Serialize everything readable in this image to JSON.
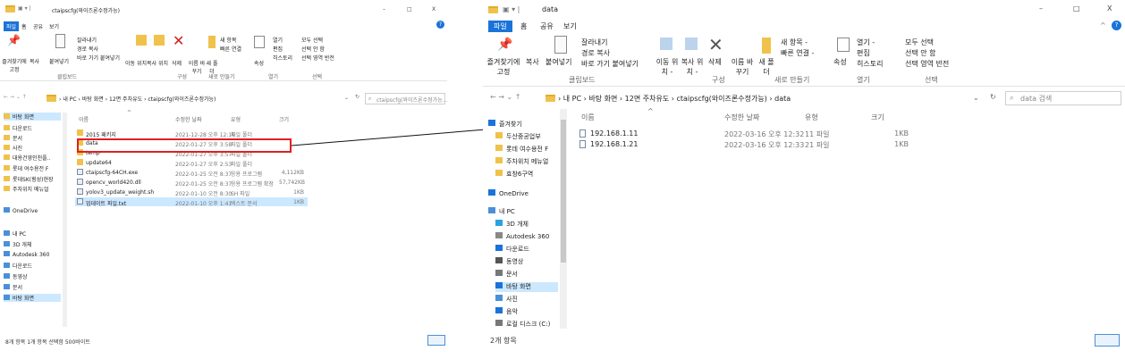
{
  "left": {
    "title": "ctaipscfg(와이즈론수정가능)",
    "tabs": [
      "파일",
      "홈",
      "공유",
      "보기"
    ],
    "ribbon": {
      "btn_pin": "즐겨찾기에 고정",
      "btn_copy": "복사",
      "btn_paste": "붙여넣기",
      "btn_cut": "잘라내기",
      "btn_copypath": "경로 복사",
      "btn_shortcut": "바로 가기 붙여넣기",
      "btn_move": "이동 위치",
      "btn_copyto": "복사 위치",
      "btn_delete": "삭제",
      "btn_rename": "이름 바꾸기",
      "btn_newfolder": "새 폴더",
      "btn_newitem": "새 항목",
      "btn_easyaccess": "빠른 연결",
      "btn_props": "속성",
      "btn_open": "열기",
      "btn_edit": "편집",
      "btn_history": "히스토리",
      "btn_selall": "모두 선택",
      "btn_selnone": "선택 안 함",
      "btn_selinv": "선택 영역 반전",
      "grp_clipboard": "클립보드",
      "grp_organize": "구성",
      "grp_new": "새로 만들기",
      "grp_open": "열기",
      "grp_select": "선택"
    },
    "breadcrumb": [
      "내 PC",
      "바탕 화면",
      "12면 주차유도",
      "ctaipscfg(와이즈론수정가능)"
    ],
    "search_placeholder": "ctaipscfg(와이즈론수정가능...",
    "columns": [
      "이름",
      "수정한 날짜",
      "유형",
      "크기"
    ],
    "files": [
      {
        "name": "2015 패키지",
        "date": "2021-12-28 오후 12:19",
        "type": "파일 폴더",
        "size": ""
      },
      {
        "name": "data",
        "date": "2022-01-27 오후 3:58",
        "type": "파일 폴더",
        "size": ""
      },
      {
        "name": "temp",
        "date": "2022-01-27 오후 3:57",
        "type": "파일 폴더",
        "size": ""
      },
      {
        "name": "update64",
        "date": "2022-01-27 오후 2:53",
        "type": "파일 폴더",
        "size": ""
      },
      {
        "name": "ctaipscfg-64CH.exe",
        "date": "2022-01-25 오전 8:37",
        "type": "응용 프로그램",
        "size": "4,112KB"
      },
      {
        "name": "opencv_world420.dll",
        "date": "2022-01-25 오전 8:37",
        "type": "응용 프로그램 확장",
        "size": "57,742KB"
      },
      {
        "name": "yolov3_update_weight.sh",
        "date": "2022-01-10 오전 8:30",
        "type": "SH 파일",
        "size": "1KB"
      },
      {
        "name": "업데이트 파일.txt",
        "date": "2022-01-10 오후 1:41",
        "type": "텍스트 문서",
        "size": "1KB"
      }
    ],
    "nav": [
      "바탕 화면",
      "다운로드",
      "문서",
      "사진",
      "대용건영인천플..",
      "롯데 여수용전 F",
      "롯데SK(횡성)현장",
      "주차위치 메뉴얼",
      "OneDrive",
      "내 PC",
      "3D 개체",
      "Autodesk 360",
      "다운로드",
      "동영상",
      "문서",
      "바탕 화면"
    ],
    "status": "8개 항목   1개 항목 선택함 500바이트"
  },
  "right": {
    "title": "data",
    "tabs": [
      "파일",
      "홈",
      "공유",
      "보기"
    ],
    "ribbon": {
      "btn_pin": "즐겨찾기에 고정",
      "btn_copy": "복사",
      "btn_paste": "붙여넣기",
      "btn_cut": "잘라내기",
      "btn_copypath": "경로 복사",
      "btn_shortcut": "바로 가기 붙여넣기",
      "btn_move": "이동 위치 -",
      "btn_copyto": "복사 위치 -",
      "btn_delete": "삭제",
      "btn_rename": "이름 바꾸기",
      "btn_newfolder": "새 폴더",
      "btn_newitem": "새 항목 -",
      "btn_easyaccess": "빠른 연결 -",
      "btn_props": "속성",
      "btn_open": "열기 -",
      "btn_edit": "편집",
      "btn_history": "히스토리",
      "btn_selall": "모두 선택",
      "btn_selnone": "선택 안 함",
      "btn_selinv": "선택 영역 반전",
      "grp_clipboard": "클립보드",
      "grp_organize": "구성",
      "grp_new": "새로 만들기",
      "grp_open": "열기",
      "grp_select": "선택"
    },
    "breadcrumb": [
      "내 PC",
      "바탕 화면",
      "12면 주차유도",
      "ctaipscfg(와이즈론수정가능)",
      "data"
    ],
    "search_placeholder": "data 검색",
    "columns": [
      "이름",
      "수정한 날짜",
      "유형",
      "크기"
    ],
    "files": [
      {
        "name": "192.168.1.11",
        "date": "2022-03-16 오후 12:32",
        "type": "11 파일",
        "size": "1KB"
      },
      {
        "name": "192.168.1.21",
        "date": "2022-03-16 오후 12:33",
        "type": "21 파일",
        "size": "1KB"
      }
    ],
    "nav": [
      "즐겨찾기",
      "두산중공업부",
      "롯데 여수용전 F",
      "주차위치 메뉴얼",
      "효창6구역",
      "OneDrive",
      "내 PC",
      "3D 개체",
      "Autodesk 360",
      "다운로드",
      "동영상",
      "문서",
      "바탕 화면",
      "사진",
      "음악",
      "로컬 디스크 (C:)"
    ],
    "status": "2개 항목"
  },
  "colors": {
    "accent": "#1a73d9",
    "highlight": "#cce8ff",
    "annotation": "#e02020",
    "folder": "#f0c24b"
  }
}
